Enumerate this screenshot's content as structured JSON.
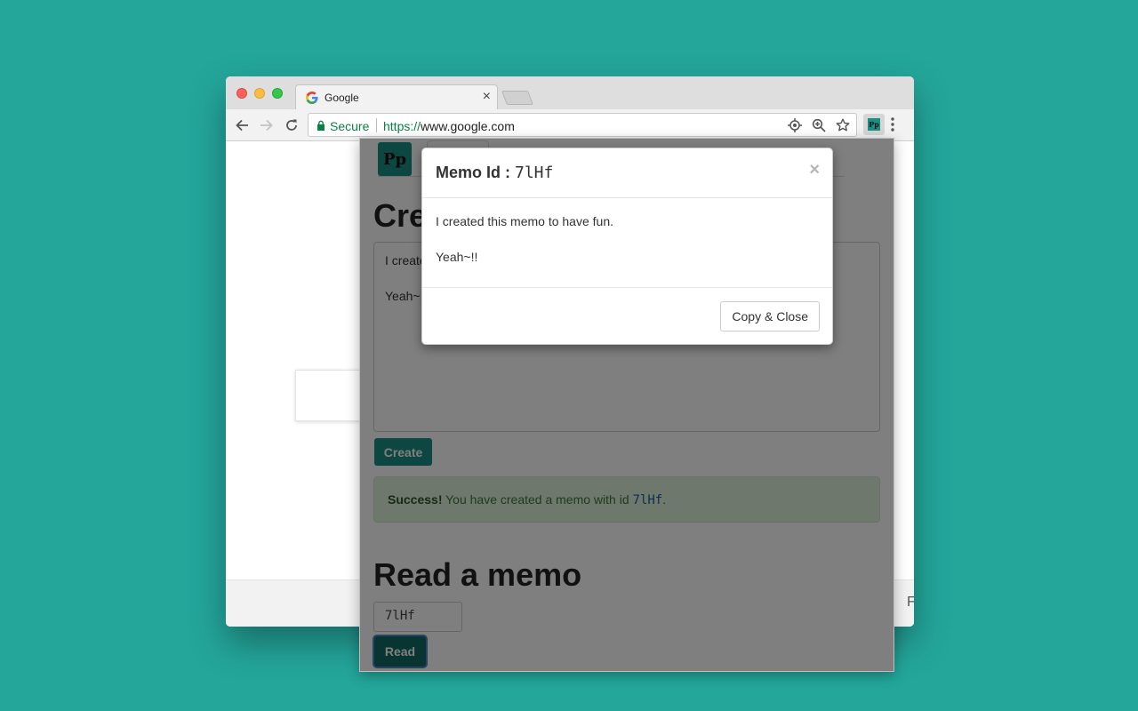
{
  "browser": {
    "tab": {
      "title": "Google",
      "close_glyph": "×"
    },
    "omnibox": {
      "secure_label": "Secure",
      "url_scheme": "https://",
      "url_host": "www.google.com"
    },
    "icons": {
      "back": "back-arrow-icon",
      "forward": "forward-arrow-icon",
      "reload": "reload-icon",
      "location": "location-target-icon",
      "zoom": "zoom-icon",
      "bookmark": "star-icon",
      "menu": "more-vert-icon"
    }
  },
  "page_footer": {
    "edge_letter": "F"
  },
  "extension": {
    "logo_text": "Pp",
    "create": {
      "heading": "Cre",
      "textarea_value": "I create\n\nYeah~!",
      "button_label": "Create"
    },
    "alert": {
      "strong": "Success!",
      "text": " You have created a memo with id ",
      "id": "7lHf",
      "tail": "."
    },
    "read": {
      "heading": "Read a memo",
      "input_value": "7lHf",
      "button_label": "Read"
    }
  },
  "modal": {
    "title_prefix": "Memo Id : ",
    "memo_id": "7lHf",
    "close_glyph": "×",
    "body": "I created this memo to have fun.\n\nYeah~!!",
    "copy_close_label": "Copy & Close"
  },
  "colors": {
    "desktop": "#24a69b",
    "brand_teal": "#1a8f84",
    "secure_green": "#0b8043",
    "success_bg": "#dff0d8"
  }
}
